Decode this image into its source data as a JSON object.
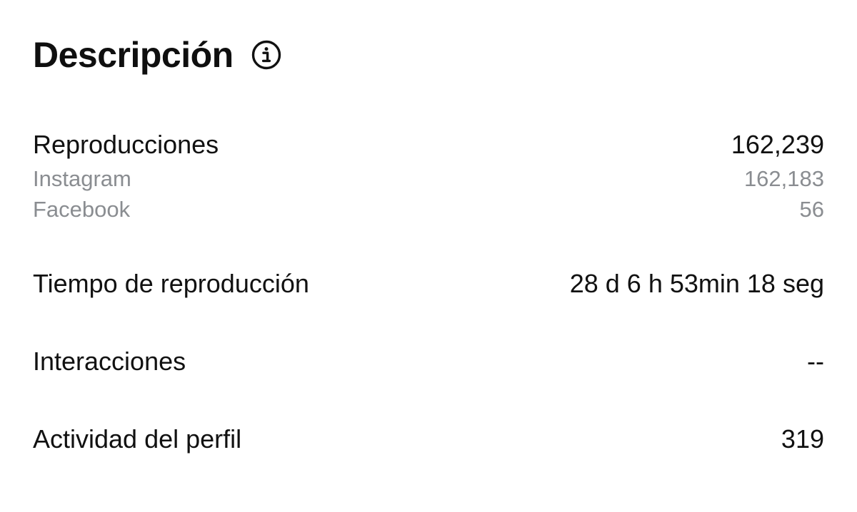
{
  "header": {
    "title": "Descripción",
    "info_icon": "info-circle-icon"
  },
  "metrics": {
    "plays": {
      "label": "Reproducciones",
      "value": "162,239",
      "breakdown": [
        {
          "label": "Instagram",
          "value": "162,183"
        },
        {
          "label": "Facebook",
          "value": "56"
        }
      ]
    },
    "watch_time": {
      "label": "Tiempo de reproducción",
      "value": "28 d 6 h 53min 18 seg"
    },
    "interactions": {
      "label": "Interacciones",
      "value": "--"
    },
    "profile_activity": {
      "label": "Actividad del perfil",
      "value": "319"
    }
  },
  "colors": {
    "primary_text": "#111111",
    "secondary_text": "#8a8d91",
    "background": "#ffffff"
  }
}
